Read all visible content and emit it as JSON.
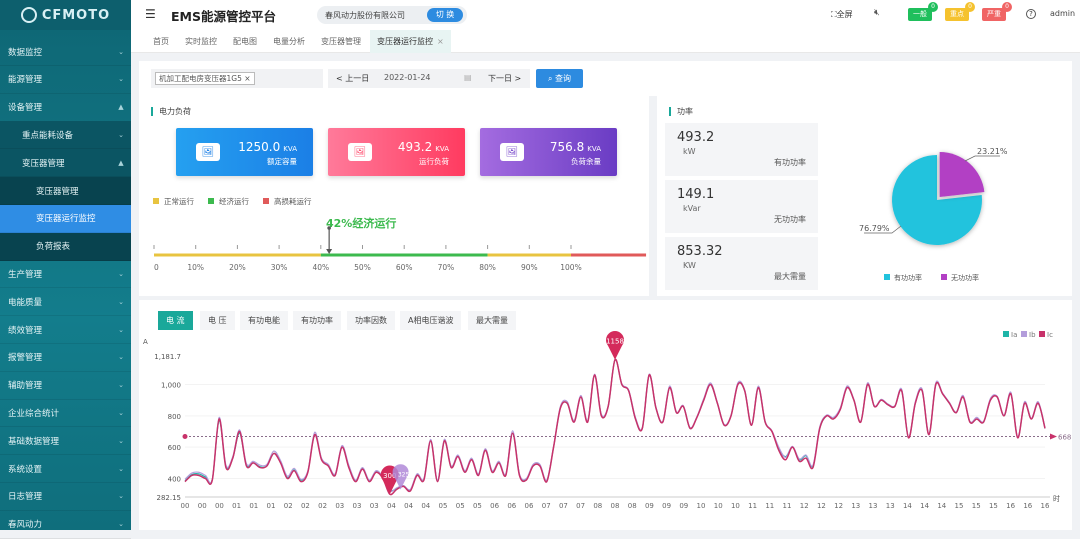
{
  "brand": "CFMOTO",
  "header": {
    "title": "EMS能源管控平台",
    "company": "春风动力股份有限公司",
    "switch_label": "切 换",
    "fullscreen_label": "全屏",
    "alerts": [
      {
        "label": "一般",
        "count": "0",
        "color": "#1fbf5c"
      },
      {
        "label": "重点",
        "count": "0",
        "color": "#f5c22e"
      },
      {
        "label": "严重",
        "count": "0",
        "color": "#f06464"
      }
    ],
    "user": "admin"
  },
  "sidebar": {
    "items": [
      {
        "label": "数据监控",
        "level": 0,
        "chev": "⌄"
      },
      {
        "label": "能源管理",
        "level": 0,
        "chev": "⌄"
      },
      {
        "label": "设备管理",
        "level": 0,
        "chev": "⌃"
      },
      {
        "label": "重点能耗设备",
        "level": 1,
        "chev": "⌄"
      },
      {
        "label": "变压器管理",
        "level": 1,
        "chev": "⌃"
      },
      {
        "label": "变压器管理",
        "level": 2
      },
      {
        "label": "变压器运行监控",
        "level": 2,
        "active": true
      },
      {
        "label": "负荷报表",
        "level": 2
      },
      {
        "label": "生产管理",
        "level": 0,
        "chev": "⌄"
      },
      {
        "label": "电能质量",
        "level": 0,
        "chev": "⌄"
      },
      {
        "label": "绩效管理",
        "level": 0,
        "chev": "⌄"
      },
      {
        "label": "报警管理",
        "level": 0,
        "chev": "⌄"
      },
      {
        "label": "辅助管理",
        "level": 0,
        "chev": "⌄"
      },
      {
        "label": "企业综合统计",
        "level": 0,
        "chev": "⌄"
      },
      {
        "label": "基础数据管理",
        "level": 0,
        "chev": "⌄"
      },
      {
        "label": "系统设置",
        "level": 0,
        "chev": "⌄"
      },
      {
        "label": "日志管理",
        "level": 0,
        "chev": "⌄"
      },
      {
        "label": "春风动力",
        "level": 0,
        "chev": "⌄"
      }
    ]
  },
  "tabs": [
    {
      "label": "首页"
    },
    {
      "label": "实时监控"
    },
    {
      "label": "配电图"
    },
    {
      "label": "电量分析"
    },
    {
      "label": "变压器管理"
    },
    {
      "label": "变压器运行监控",
      "active": true
    }
  ],
  "filter": {
    "device_tag": "机加工配电房变压器1G5",
    "prev_label": "< 上一日",
    "date": "2022-01-24",
    "next_label": "下一日 >",
    "query_label": "查询"
  },
  "load": {
    "title": "电力负荷",
    "cards": [
      {
        "value": "1250.0",
        "unit": "KVA",
        "label": "额定容量"
      },
      {
        "value": "493.2",
        "unit": "KVA",
        "label": "运行负荷"
      },
      {
        "value": "756.8",
        "unit": "KVA",
        "label": "负荷余量"
      }
    ],
    "legend": [
      {
        "label": "正常运行",
        "color": "#e8c440"
      },
      {
        "label": "经济运行",
        "color": "#3cba4e"
      },
      {
        "label": "高损耗运行",
        "color": "#e05a5a"
      }
    ],
    "gauge_ticks": [
      "0",
      "10%",
      "20%",
      "30%",
      "40%",
      "50%",
      "60%",
      "70%",
      "80%",
      "90%",
      "100%"
    ],
    "load_rate": 42,
    "status_text": "42%经济运行"
  },
  "power": {
    "title": "功率",
    "cards": [
      {
        "value": "493.2",
        "unit": "kW",
        "label": "有功功率"
      },
      {
        "value": "149.1",
        "unit": "kVar",
        "label": "无功功率"
      },
      {
        "value": "853.32",
        "unit": "KW",
        "label": "最大需量"
      }
    ],
    "pie": {
      "slices": [
        {
          "name": "有功功率",
          "pct": "76.79%",
          "value": 76.79,
          "color": "#22c3dd"
        },
        {
          "name": "无功功率",
          "pct": "23.21%",
          "value": 23.21,
          "color": "#b23fc4"
        }
      ]
    }
  },
  "chart_tabs": [
    {
      "label": "电 流",
      "active": true
    },
    {
      "label": "电 压"
    },
    {
      "label": "有功电能"
    },
    {
      "label": "有功功率"
    },
    {
      "label": "功率因数"
    },
    {
      "label": "A相电压谐波"
    },
    {
      "label": "最大需量"
    }
  ],
  "chart_data": {
    "type": "line",
    "ylabel": "A",
    "xlabel": "时",
    "ylim": [
      282.15,
      1181.7
    ],
    "yticks": [
      "1,181.7",
      "1,000",
      "800",
      "600",
      "400",
      "282.15"
    ],
    "ytick_values": [
      1181.7,
      1000,
      800,
      600,
      400,
      282.15
    ],
    "categories": [
      "00",
      "00",
      "00",
      "01",
      "01",
      "01",
      "02",
      "02",
      "02",
      "03",
      "03",
      "03",
      "04",
      "04",
      "04",
      "05",
      "05",
      "05",
      "06",
      "06",
      "06",
      "07",
      "07",
      "07",
      "08",
      "08",
      "08",
      "09",
      "09",
      "09",
      "10",
      "10",
      "10",
      "11",
      "11",
      "11",
      "12",
      "12",
      "12",
      "13",
      "13",
      "13",
      "14",
      "14",
      "14",
      "15",
      "15",
      "15",
      "16",
      "16",
      "16"
    ],
    "mark_max": "1158",
    "mark_min": "300",
    "mark_min_b": "325",
    "mark_line": "668",
    "legend_position": "top-right",
    "series": [
      {
        "name": "Ia",
        "color": "#1fb5a8",
        "values": [
          385,
          425,
          430,
          410,
          395,
          770,
          475,
          530,
          690,
          485,
          500,
          475,
          480,
          560,
          505,
          405,
          455,
          390,
          445,
          680,
          525,
          480,
          425,
          600,
          475,
          385,
          465,
          385,
          445,
          405,
          325,
          335,
          355,
          325,
          425,
          395,
          640,
          385,
          640,
          475,
          545,
          445,
          525,
          425,
          585,
          445,
          505,
          425,
          690,
          425,
          395,
          480,
          485,
          385,
          600,
          850,
          880,
          765,
          920,
          765,
          1060,
          805,
          860,
          1158,
          1000,
          960,
          780,
          720,
          1060,
          850,
          760,
          980,
          820,
          860,
          720,
          790,
          900,
          1000,
          880,
          740,
          800,
          1000,
          960,
          740,
          980,
          760,
          700,
          590,
          540,
          600,
          520,
          545,
          480,
          720,
          800,
          780,
          840,
          980,
          900,
          760,
          1000,
          860,
          900,
          870,
          860,
          960,
          660,
          880,
          960,
          680,
          1000,
          940,
          880,
          820,
          920,
          760,
          780,
          760,
          900,
          920,
          800,
          940,
          660,
          880,
          780,
          880,
          720
        ]
      },
      {
        "name": "Ib",
        "color": "#b39ddb",
        "values": [
          395,
          435,
          440,
          420,
          395,
          790,
          485,
          540,
          710,
          495,
          510,
          485,
          490,
          575,
          515,
          415,
          465,
          395,
          450,
          695,
          530,
          490,
          430,
          610,
          485,
          390,
          470,
          390,
          450,
          410,
          320,
          340,
          355,
          330,
          430,
          400,
          650,
          390,
          650,
          480,
          550,
          450,
          530,
          430,
          590,
          450,
          510,
          430,
          705,
          430,
          400,
          490,
          490,
          390,
          605,
          860,
          890,
          770,
          930,
          770,
          1065,
          810,
          865,
          1158,
          1005,
          965,
          790,
          725,
          1065,
          855,
          765,
          990,
          825,
          865,
          725,
          795,
          910,
          1010,
          885,
          745,
          805,
          1010,
          965,
          745,
          990,
          765,
          705,
          600,
          535,
          605,
          525,
          550,
          485,
          730,
          805,
          790,
          850,
          990,
          905,
          765,
          1010,
          865,
          905,
          875,
          865,
          970,
          665,
          890,
          970,
          685,
          1010,
          945,
          885,
          825,
          930,
          765,
          790,
          765,
          910,
          925,
          805,
          950,
          665,
          890,
          785,
          890,
          725
        ]
      },
      {
        "name": "Ic",
        "color": "#c8326a",
        "values": [
          380,
          420,
          420,
          400,
          390,
          780,
          470,
          530,
          700,
          480,
          500,
          470,
          480,
          560,
          500,
          400,
          450,
          380,
          440,
          680,
          520,
          480,
          420,
          600,
          470,
          380,
          460,
          380,
          440,
          400,
          300,
          330,
          350,
          320,
          420,
          390,
          640,
          380,
          640,
          470,
          540,
          440,
          520,
          420,
          580,
          440,
          500,
          420,
          690,
          420,
          390,
          480,
          480,
          380,
          600,
          850,
          880,
          760,
          920,
          760,
          1060,
          800,
          860,
          1158,
          1000,
          960,
          780,
          720,
          1060,
          850,
          760,
          980,
          820,
          860,
          720,
          790,
          900,
          1000,
          880,
          740,
          800,
          1000,
          960,
          740,
          980,
          760,
          700,
          580,
          520,
          600,
          510,
          530,
          470,
          720,
          800,
          780,
          840,
          980,
          900,
          760,
          1000,
          860,
          900,
          870,
          860,
          960,
          660,
          880,
          960,
          680,
          1000,
          940,
          880,
          820,
          920,
          760,
          780,
          760,
          900,
          920,
          800,
          940,
          660,
          880,
          780,
          880,
          720
        ]
      }
    ]
  }
}
